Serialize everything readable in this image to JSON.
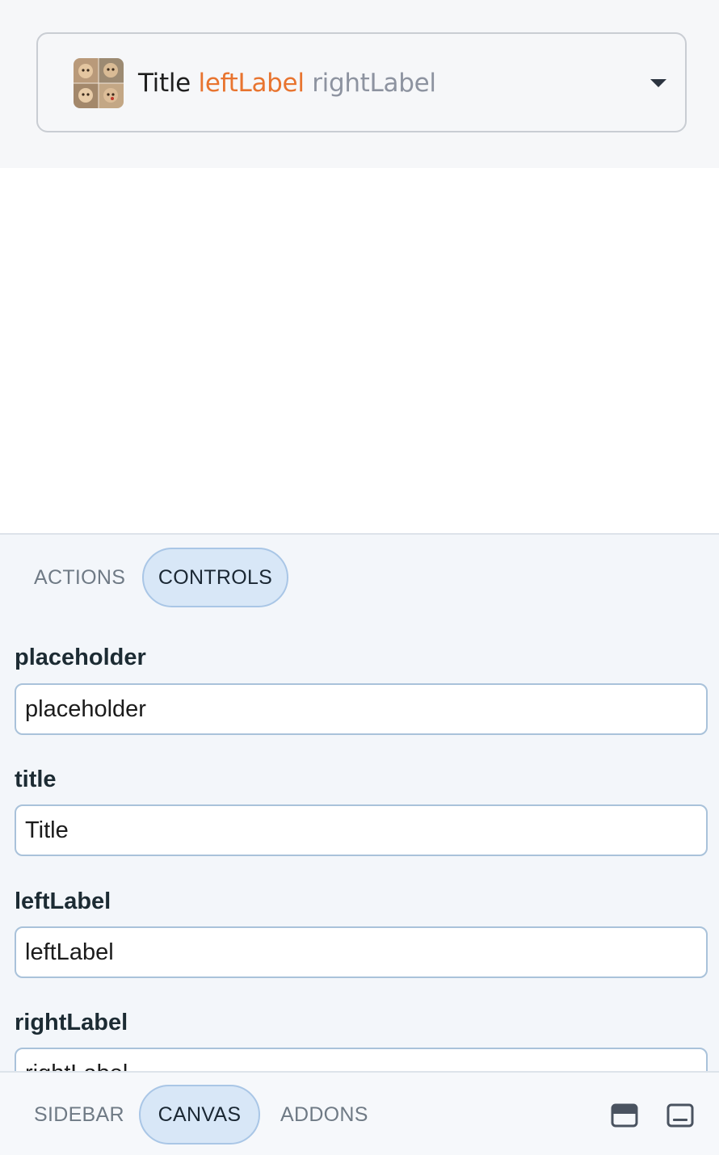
{
  "preview": {
    "select": {
      "title": "Title",
      "left_label": "leftLabel",
      "right_label": "rightLabel",
      "icons": {
        "thumbnail": "cat-photos-thumbnail",
        "dropdown": "chevron-down-icon"
      }
    }
  },
  "addons_panel": {
    "tabs": [
      {
        "label": "ACTIONS",
        "active": false
      },
      {
        "label": "CONTROLS",
        "active": true
      }
    ],
    "controls": [
      {
        "label": "placeholder",
        "value": "placeholder"
      },
      {
        "label": "title",
        "value": "Title"
      },
      {
        "label": "leftLabel",
        "value": "leftLabel"
      },
      {
        "label": "rightLabel",
        "value": "rightLabel"
      }
    ]
  },
  "bottom_nav": {
    "tabs": [
      {
        "label": "SIDEBAR",
        "active": false
      },
      {
        "label": "CANVAS",
        "active": true
      },
      {
        "label": "ADDONS",
        "active": false
      }
    ],
    "icons": [
      "panel-top-icon",
      "panel-bottom-icon"
    ]
  },
  "colors": {
    "left_label": "#e8742f",
    "right_label": "#8d93a0",
    "active_tab_bg": "#d8e7f7",
    "input_border": "#a9c2da"
  }
}
